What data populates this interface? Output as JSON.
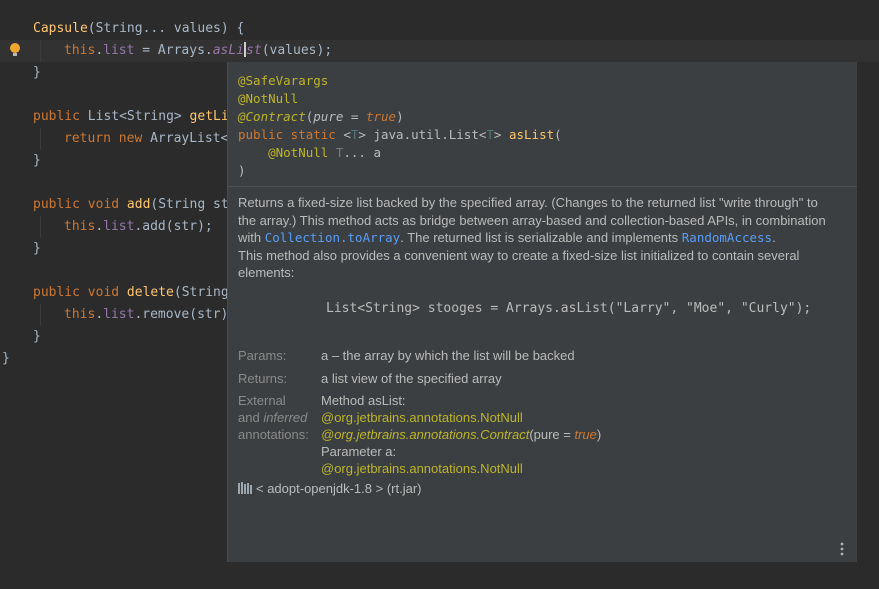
{
  "editor": {
    "lines": [
      {
        "parts": [
          [
            "fn",
            "Capsule"
          ],
          [
            "txt",
            "(String... values) {"
          ]
        ]
      },
      {
        "indent": 1,
        "parts": [
          [
            "kw",
            "this"
          ],
          [
            "txt",
            "."
          ],
          [
            "fld",
            "list"
          ],
          [
            "txt",
            " = Arrays."
          ],
          [
            "fldi",
            "asLi"
          ],
          [
            "caret",
            ""
          ],
          [
            "fldi",
            "st"
          ],
          [
            "txt",
            "(values);"
          ]
        ]
      },
      {
        "parts": [
          [
            "txt",
            "}"
          ]
        ]
      },
      {
        "parts": []
      },
      {
        "parts": [
          [
            "kw",
            "public "
          ],
          [
            "txt",
            "List<String> "
          ],
          [
            "fn",
            "getLi"
          ]
        ]
      },
      {
        "indent": 1,
        "parts": [
          [
            "kw",
            "return new "
          ],
          [
            "txt",
            "ArrayList<"
          ]
        ]
      },
      {
        "parts": [
          [
            "txt",
            "}"
          ]
        ]
      },
      {
        "parts": []
      },
      {
        "parts": [
          [
            "kw",
            "public void "
          ],
          [
            "fn",
            "add"
          ],
          [
            "txt",
            "(String st"
          ]
        ]
      },
      {
        "indent": 1,
        "parts": [
          [
            "kw",
            "this"
          ],
          [
            "txt",
            "."
          ],
          [
            "fld",
            "list"
          ],
          [
            "txt",
            ".add(str);"
          ]
        ]
      },
      {
        "parts": [
          [
            "txt",
            "}"
          ]
        ]
      },
      {
        "parts": []
      },
      {
        "parts": [
          [
            "kw",
            "public void "
          ],
          [
            "fn",
            "delete"
          ],
          [
            "txt",
            "(String"
          ]
        ]
      },
      {
        "indent": 1,
        "parts": [
          [
            "kw",
            "this"
          ],
          [
            "txt",
            "."
          ],
          [
            "fld",
            "list"
          ],
          [
            "txt",
            ".remove(str)"
          ]
        ]
      },
      {
        "parts": [
          [
            "txt",
            "}"
          ]
        ]
      },
      {
        "outer": true,
        "parts": [
          [
            "txt",
            "}"
          ]
        ]
      }
    ]
  },
  "popup": {
    "signature": {
      "ann1": "@SafeVarargs",
      "ann2": "@NotNull",
      "contract_name": "@Contract",
      "contract_open": "(",
      "contract_key": "pure",
      "contract_eq": " = ",
      "contract_val": "true",
      "contract_close": ")",
      "mod": "public static ",
      "lt": "<",
      "type_param": "T",
      "gt": "> ",
      "ret": "java.util.List<",
      "ret_param": "T",
      "ret_close": "> ",
      "method": "asList",
      "open_paren": "(",
      "param_ann": "@NotNull ",
      "param_type": "T",
      "param_rest": "... a",
      "close_paren": ")"
    },
    "description": {
      "p1_a": "Returns a fixed-size list backed by the specified array. (Changes to the returned list \"write through\" to the array.) This method acts as bridge between array-based and collection-based APIs, in combination with ",
      "link1": "Collection.toArray",
      "p1_b": ". The returned list is serializable and implements ",
      "link2": "RandomAccess",
      "p1_c": ".",
      "p2": "This method also provides a convenient way to create a fixed-size list initialized to contain several elements:"
    },
    "example": "List<String> stooges = Arrays.asList(\"Larry\", \"Moe\", \"Curly\");",
    "params_label": "Params:",
    "params_value": "a – the array by which the list will be backed",
    "returns_label": "Returns:",
    "returns_value": "a list view of the specified array",
    "external_label_1": "External",
    "external_label_2a": "and ",
    "external_label_2b": "inferred",
    "external_label_3": "annotations:",
    "ext_method": "Method asList:",
    "ext_notnull": "@org.jetbrains.annotations.NotNull",
    "ext_contract": "@org.jetbrains.annotations.Contract",
    "ext_contract_open": "(pure = ",
    "ext_contract_val": "true",
    "ext_contract_close": ")",
    "ext_param": "Parameter a:",
    "ext_param_notnull": "@org.jetbrains.annotations.NotNull",
    "library": "< adopt-openjdk-1.8 > (rt.jar)",
    "library_icon": "library-icon",
    "more_icon": "more-vertical-icon"
  }
}
